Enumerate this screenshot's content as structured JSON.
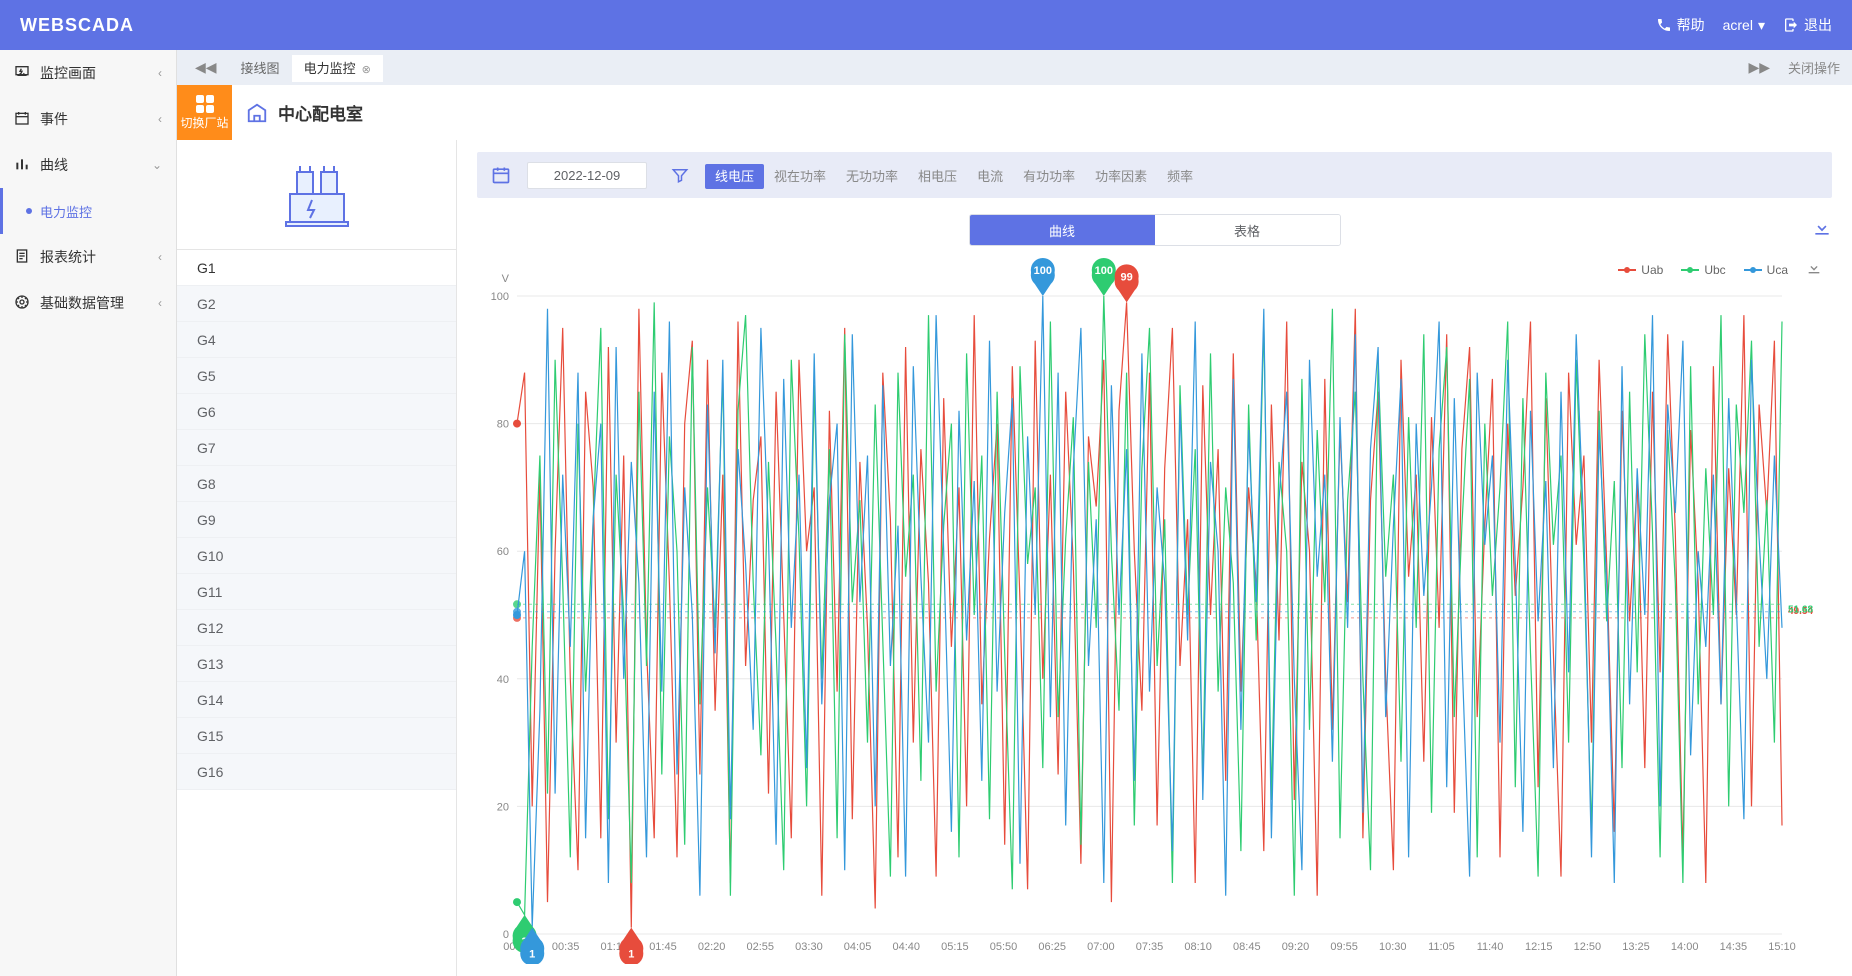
{
  "header": {
    "logo": "WEBSCADA",
    "help": "帮助",
    "user": "acrel",
    "logout": "退出"
  },
  "sidebar": {
    "items": [
      {
        "label": "监控画面",
        "icon": "monitor-icon",
        "expandable": true
      },
      {
        "label": "事件",
        "icon": "event-icon",
        "expandable": true
      },
      {
        "label": "曲线",
        "icon": "chart-icon",
        "expanded": true,
        "children": [
          {
            "label": "电力监控",
            "active": true
          }
        ]
      },
      {
        "label": "报表统计",
        "icon": "report-icon",
        "expandable": true
      },
      {
        "label": "基础数据管理",
        "icon": "settings-icon",
        "expandable": true
      }
    ]
  },
  "tabs": {
    "list": [
      {
        "label": "接线图",
        "active": false
      },
      {
        "label": "电力监控",
        "active": true
      }
    ],
    "close_ops": "关闭操作"
  },
  "switch_station": "切换厂站",
  "page_title": "中心配电室",
  "device_list": [
    "G1",
    "G2",
    "G4",
    "G5",
    "G6",
    "G7",
    "G8",
    "G9",
    "G10",
    "G11",
    "G12",
    "G13",
    "G14",
    "G15",
    "G16"
  ],
  "device_active": "G1",
  "filter": {
    "date": "2022-12-09",
    "metrics": [
      "线电压",
      "视在功率",
      "无功功率",
      "相电压",
      "电流",
      "有功功率",
      "功率因素",
      "频率"
    ],
    "metric_active": "线电压"
  },
  "view_toggle": {
    "curve": "曲线",
    "table": "表格",
    "active": "曲线"
  },
  "chart_data": {
    "type": "line",
    "ylabel": "V",
    "ylim": [
      0,
      100
    ],
    "yticks": [
      0,
      20,
      40,
      60,
      80,
      100
    ],
    "x_categories": [
      "00:00",
      "00:35",
      "01:10",
      "01:45",
      "02:20",
      "02:55",
      "03:30",
      "04:05",
      "04:40",
      "05:15",
      "05:50",
      "06:25",
      "07:00",
      "07:35",
      "08:10",
      "08:45",
      "09:20",
      "09:55",
      "10:30",
      "11:05",
      "11:40",
      "12:15",
      "12:50",
      "13:25",
      "14:00",
      "14:35",
      "15:10"
    ],
    "series": [
      {
        "name": "Uab",
        "color": "#e74c3c",
        "avg": 49.54,
        "values": [
          80,
          88,
          20,
          72,
          5,
          60,
          95,
          40,
          10,
          85,
          70,
          15,
          92,
          30,
          75,
          1,
          98,
          45,
          15,
          88,
          55,
          12,
          80,
          93,
          25,
          90,
          35,
          72,
          8,
          96,
          42,
          68,
          78,
          22,
          85,
          50,
          15,
          90,
          60,
          70,
          6,
          82,
          38,
          95,
          18,
          74,
          48,
          4,
          88,
          65,
          12,
          92,
          30,
          76,
          55,
          9,
          84,
          45,
          70,
          20,
          97,
          36,
          62,
          80,
          14,
          89,
          52,
          7,
          93,
          40,
          72,
          25,
          85,
          58,
          11,
          78,
          67,
          90,
          5,
          82,
          99,
          60,
          35,
          88,
          17,
          73,
          95,
          42,
          65,
          8,
          86,
          50,
          76,
          24,
          91,
          38,
          70,
          55,
          13,
          83,
          46,
          96,
          21,
          74,
          60,
          6,
          87,
          32,
          79,
          52,
          98,
          15,
          68,
          85,
          40,
          10,
          90,
          56,
          72,
          27,
          81,
          48,
          94,
          19,
          76,
          92,
          34,
          64,
          87,
          12,
          80,
          53,
          70,
          96,
          23,
          84,
          44,
          9,
          88,
          61,
          75,
          30,
          90,
          58,
          16,
          82,
          49,
          71,
          26,
          85,
          41,
          94,
          63,
          12,
          79,
          55,
          8,
          89,
          36,
          73,
          50,
          97,
          20,
          83,
          66,
          93,
          17
        ]
      },
      {
        "name": "Ubc",
        "color": "#2ecc71",
        "avg": 51.68,
        "values": [
          5,
          3,
          45,
          75,
          22,
          90,
          55,
          12,
          80,
          38,
          65,
          95,
          18,
          72,
          50,
          8,
          85,
          42,
          99,
          25,
          78,
          60,
          14,
          92,
          36,
          70,
          48,
          88,
          6,
          82,
          97,
          55,
          28,
          74,
          45,
          10,
          90,
          62,
          20,
          86,
          40,
          76,
          15,
          94,
          52,
          68,
          30,
          83,
          46,
          9,
          88,
          56,
          72,
          24,
          97,
          38,
          64,
          80,
          12,
          91,
          50,
          75,
          18,
          85,
          44,
          7,
          89,
          58,
          70,
          26,
          96,
          34,
          62,
          81,
          14,
          74,
          48,
          100,
          60,
          35,
          88,
          17,
          73,
          95,
          42,
          65,
          8,
          86,
          50,
          76,
          24,
          91,
          38,
          70,
          55,
          13,
          83,
          46,
          96,
          21,
          74,
          60,
          6,
          87,
          32,
          79,
          52,
          98,
          15,
          68,
          85,
          40,
          10,
          90,
          56,
          72,
          27,
          81,
          48,
          94,
          19,
          76,
          92,
          34,
          64,
          87,
          12,
          80,
          53,
          70,
          96,
          23,
          84,
          44,
          9,
          88,
          61,
          75,
          30,
          90,
          58,
          16,
          82,
          49,
          71,
          26,
          85,
          41,
          94,
          63,
          12,
          79,
          55,
          8,
          89,
          36,
          73,
          50,
          97,
          20,
          83,
          66,
          93,
          45,
          68,
          30,
          96
        ]
      },
      {
        "name": "Uca",
        "color": "#3498db",
        "avg": 50.5,
        "values": [
          50,
          60,
          1,
          35,
          98,
          22,
          72,
          45,
          88,
          15,
          65,
          80,
          8,
          92,
          40,
          74,
          55,
          12,
          85,
          38,
          96,
          25,
          70,
          50,
          6,
          83,
          44,
          90,
          18,
          76,
          58,
          32,
          95,
          62,
          14,
          87,
          48,
          72,
          26,
          91,
          36,
          68,
          80,
          10,
          94,
          52,
          75,
          20,
          86,
          42,
          64,
          9,
          89,
          56,
          30,
          97,
          60,
          16,
          82,
          46,
          71,
          24,
          93,
          38,
          66,
          84,
          11,
          78,
          50,
          100,
          34,
          88,
          17,
          73,
          95,
          42,
          65,
          8,
          86,
          50,
          76,
          24,
          91,
          38,
          70,
          55,
          13,
          83,
          46,
          96,
          21,
          74,
          60,
          6,
          87,
          32,
          79,
          52,
          98,
          15,
          68,
          85,
          40,
          10,
          90,
          56,
          72,
          27,
          81,
          48,
          94,
          19,
          76,
          92,
          34,
          64,
          87,
          12,
          80,
          53,
          70,
          96,
          23,
          84,
          44,
          9,
          88,
          61,
          75,
          30,
          90,
          58,
          16,
          82,
          49,
          71,
          26,
          85,
          41,
          94,
          63,
          12,
          79,
          55,
          8,
          89,
          36,
          73,
          50,
          97,
          20,
          83,
          66,
          93,
          28,
          60,
          45,
          72,
          36,
          84,
          52,
          18,
          90,
          62,
          40,
          75,
          48
        ]
      }
    ],
    "pins": [
      {
        "series": "Ubc",
        "label": "3",
        "type": "min",
        "xi": 1
      },
      {
        "series": "Uca",
        "label": "1",
        "type": "min",
        "xi": 2
      },
      {
        "series": "Uab",
        "label": "1",
        "type": "min",
        "xi": 15
      },
      {
        "series": "Ubc",
        "label": "100",
        "type": "max",
        "xi": 77
      },
      {
        "series": "Uab",
        "label": "99",
        "type": "max",
        "xi": 80
      },
      {
        "series": "Uca",
        "label": "100",
        "type": "max",
        "xi": 69
      }
    ],
    "avg_labels": {
      "Uab": "49.54",
      "Ubc": "51.68"
    }
  }
}
